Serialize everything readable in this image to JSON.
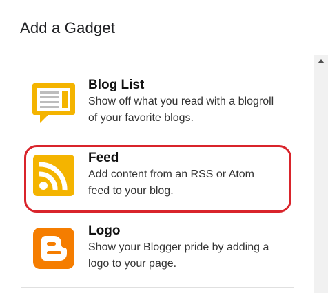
{
  "dialog": {
    "title": "Add a Gadget"
  },
  "gadgets": [
    {
      "name": "Blog List",
      "desc_line1": "Show off what you read with a blogroll",
      "desc_line2": "of your favorite blogs.",
      "icon": "blog-list-icon",
      "color": "#f4b400"
    },
    {
      "name": "Feed",
      "desc_line1": "Add content from an RSS or Atom",
      "desc_line2": "feed to your blog.",
      "icon": "rss-feed-icon",
      "color": "#f4b400",
      "highlighted": true
    },
    {
      "name": "Logo",
      "desc_line1": "Show your Blogger pride by adding a",
      "desc_line2": "logo to your page.",
      "icon": "blogger-logo-icon",
      "color": "#f57d00"
    }
  ],
  "colors": {
    "highlight": "#d9242b",
    "divider": "#e0e0e0"
  }
}
